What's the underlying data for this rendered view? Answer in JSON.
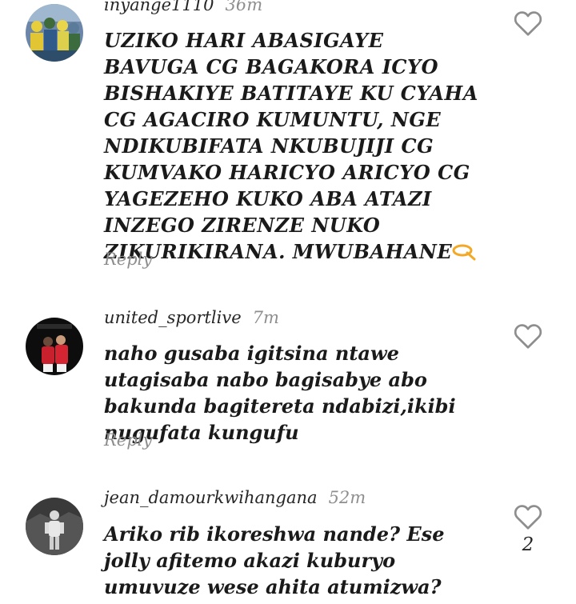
{
  "comments": [
    {
      "username": "inyange1110",
      "time": "36m",
      "text": "UZIKO HARI ABASIGAYE BAVUGA CG BAGAKORA ICYO BISHAKIYE BATITAYE KU CYAHA CG AGACIRO KUMUNTU, NGE NDIKUBIFATA NKUBUJIJI CG KUMVAKO HARICYO ARICYO CG YAGEZEHO KUKO ABA ATAZI INZEGO ZIRENZE NUKO ZIKURIKIRANA. MWUBAHANE",
      "reply_label": "Reply",
      "avatar_icon": "crowd-photo-avatar"
    },
    {
      "username": "united_sportlive",
      "time": "7m",
      "text": "naho gusaba igitsina ntawe utagisaba nabo bagisabye abo bakunda bagitereta ndabizi,ikibi nugufata kungufu",
      "reply_label": "Reply",
      "avatar_icon": "football-players-avatar"
    },
    {
      "username": "jean_damourkwihangana",
      "time": "52m",
      "text": "Ariko rib ikoreshwa nande? Ese jolly afitemo akazi kuburyo umuvuze wese ahita atumizwa?",
      "like_count": "2",
      "avatar_icon": "person-standing-avatar"
    }
  ],
  "colors": {
    "text": "#1a1a1a",
    "muted": "#8e8e8e",
    "heart_outline": "#8e8e8e"
  }
}
